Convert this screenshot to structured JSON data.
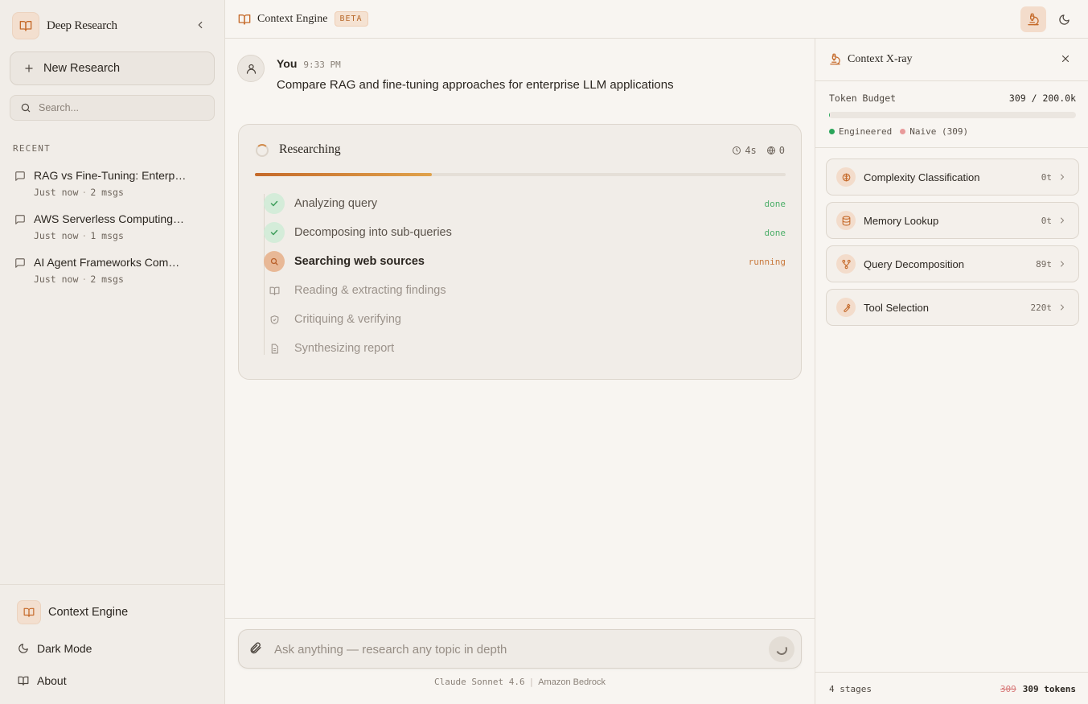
{
  "sidebar": {
    "brand_title": "Deep Research",
    "new_research_label": "New Research",
    "search_placeholder": "Search...",
    "recent_label": "RECENT",
    "recent": [
      {
        "title": "RAG vs Fine-Tuning: Enterp…",
        "time": "Just now",
        "msgs": "2 msgs"
      },
      {
        "title": "AWS Serverless Computing…",
        "time": "Just now",
        "msgs": "1 msgs"
      },
      {
        "title": "AI Agent Frameworks Com…",
        "time": "Just now",
        "msgs": "2 msgs"
      }
    ],
    "footer": {
      "brand": "Context Engine",
      "dark_mode": "Dark Mode",
      "about": "About"
    }
  },
  "topbar": {
    "title": "Context Engine",
    "badge": "BETA"
  },
  "chat": {
    "message": {
      "author": "You",
      "time": "9:33 PM",
      "text": "Compare RAG and fine-tuning approaches for enterprise LLM applications"
    },
    "research": {
      "title": "Researching",
      "elapsed": "4s",
      "sources": "0",
      "progress": 0.333,
      "steps": [
        {
          "label": "Analyzing query",
          "status": "done"
        },
        {
          "label": "Decomposing into sub-queries",
          "status": "done"
        },
        {
          "label": "Searching web sources",
          "status": "running"
        },
        {
          "label": "Reading & extracting findings",
          "status": ""
        },
        {
          "label": "Critiquing & verifying",
          "status": ""
        },
        {
          "label": "Synthesizing report",
          "status": ""
        }
      ]
    }
  },
  "composer": {
    "placeholder": "Ask anything — research any topic in depth",
    "model": "Claude Sonnet 4.6",
    "provider": "Amazon Bedrock"
  },
  "xray": {
    "title": "Context X-ray",
    "budget_label": "Token Budget",
    "budget_value": "309 / 200.0k",
    "budget_fraction": 0.0015,
    "legend_engineered": "Engineered",
    "legend_naive": "Naive (309)",
    "colors": {
      "engineered": "#2aa55a",
      "naive": "#e89a9a",
      "accent": "#c56a2a"
    },
    "stages": [
      {
        "label": "Complexity Classification",
        "tokens": "0t",
        "icon": "brain-icon"
      },
      {
        "label": "Memory Lookup",
        "tokens": "0t",
        "icon": "database-icon"
      },
      {
        "label": "Query Decomposition",
        "tokens": "89t",
        "icon": "branch-icon"
      },
      {
        "label": "Tool Selection",
        "tokens": "220t",
        "icon": "wrench-icon"
      }
    ],
    "footer_stages": "4 stages",
    "footer_naive": "309",
    "footer_tokens": "309 tokens"
  }
}
